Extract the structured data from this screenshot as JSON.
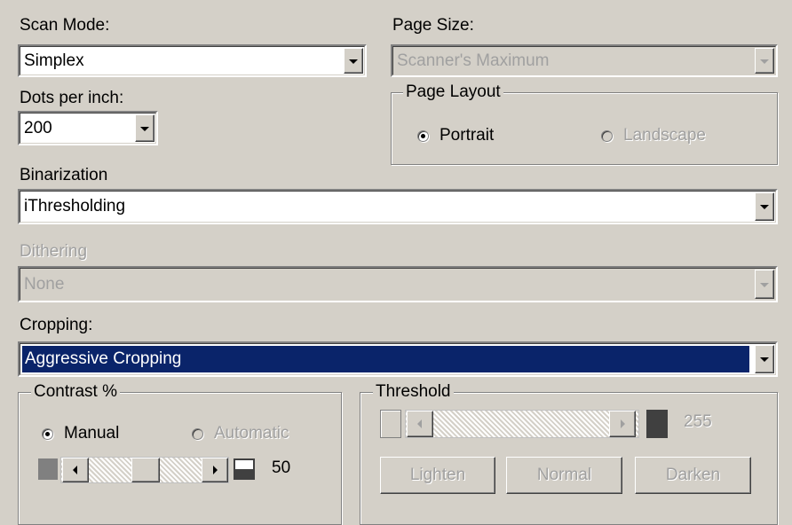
{
  "scan_mode": {
    "label": "Scan Mode:",
    "value": "Simplex"
  },
  "page_size": {
    "label": "Page Size:",
    "value": "Scanner's Maximum"
  },
  "dpi": {
    "label": "Dots per inch:",
    "value": "200"
  },
  "page_layout": {
    "legend": "Page Layout",
    "options": [
      {
        "label": "Portrait",
        "selected": true,
        "enabled": true
      },
      {
        "label": "Landscape",
        "selected": false,
        "enabled": false
      }
    ]
  },
  "binarization": {
    "label": "Binarization",
    "value": "iThresholding"
  },
  "dithering": {
    "label": "Dithering",
    "value": "None"
  },
  "cropping": {
    "label": "Cropping:",
    "value": "Aggressive Cropping"
  },
  "contrast": {
    "legend": "Contrast %",
    "options": [
      {
        "label": "Manual",
        "selected": true,
        "enabled": true
      },
      {
        "label": "Automatic",
        "selected": false,
        "enabled": false
      }
    ],
    "value": "50"
  },
  "threshold": {
    "legend": "Threshold",
    "value": "255",
    "buttons": {
      "lighten": "Lighten",
      "normal": "Normal",
      "darken": "Darken"
    }
  },
  "colors": {
    "selection": "#0a246a",
    "face": "#d4d0c8"
  }
}
